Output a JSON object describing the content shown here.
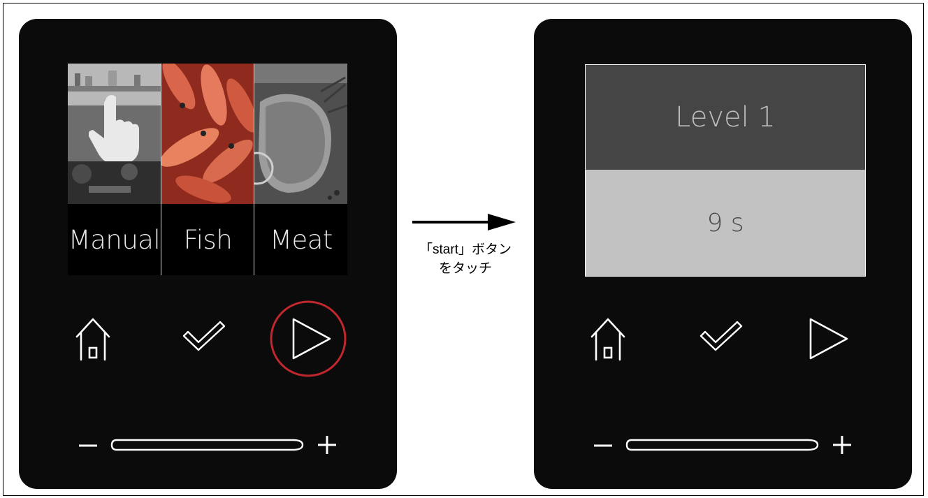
{
  "left_panel": {
    "modes": [
      {
        "label": "Manual",
        "icon": "hand-pointer-icon"
      },
      {
        "label": "Fish"
      },
      {
        "label": "Meat"
      }
    ],
    "controls": [
      "home-icon",
      "check-icon",
      "play-icon"
    ],
    "highlighted_control": "play-icon",
    "highlight_color": "#c0282d",
    "slider_minus": "−",
    "slider_plus": "+"
  },
  "transition": {
    "caption_line1": "「start」ボタン",
    "caption_line2": "をタッチ"
  },
  "right_panel": {
    "level_label": "Level 1",
    "time_label": "9 s",
    "controls": [
      "home-icon",
      "check-icon",
      "play-icon"
    ],
    "slider_minus": "−",
    "slider_plus": "+"
  }
}
